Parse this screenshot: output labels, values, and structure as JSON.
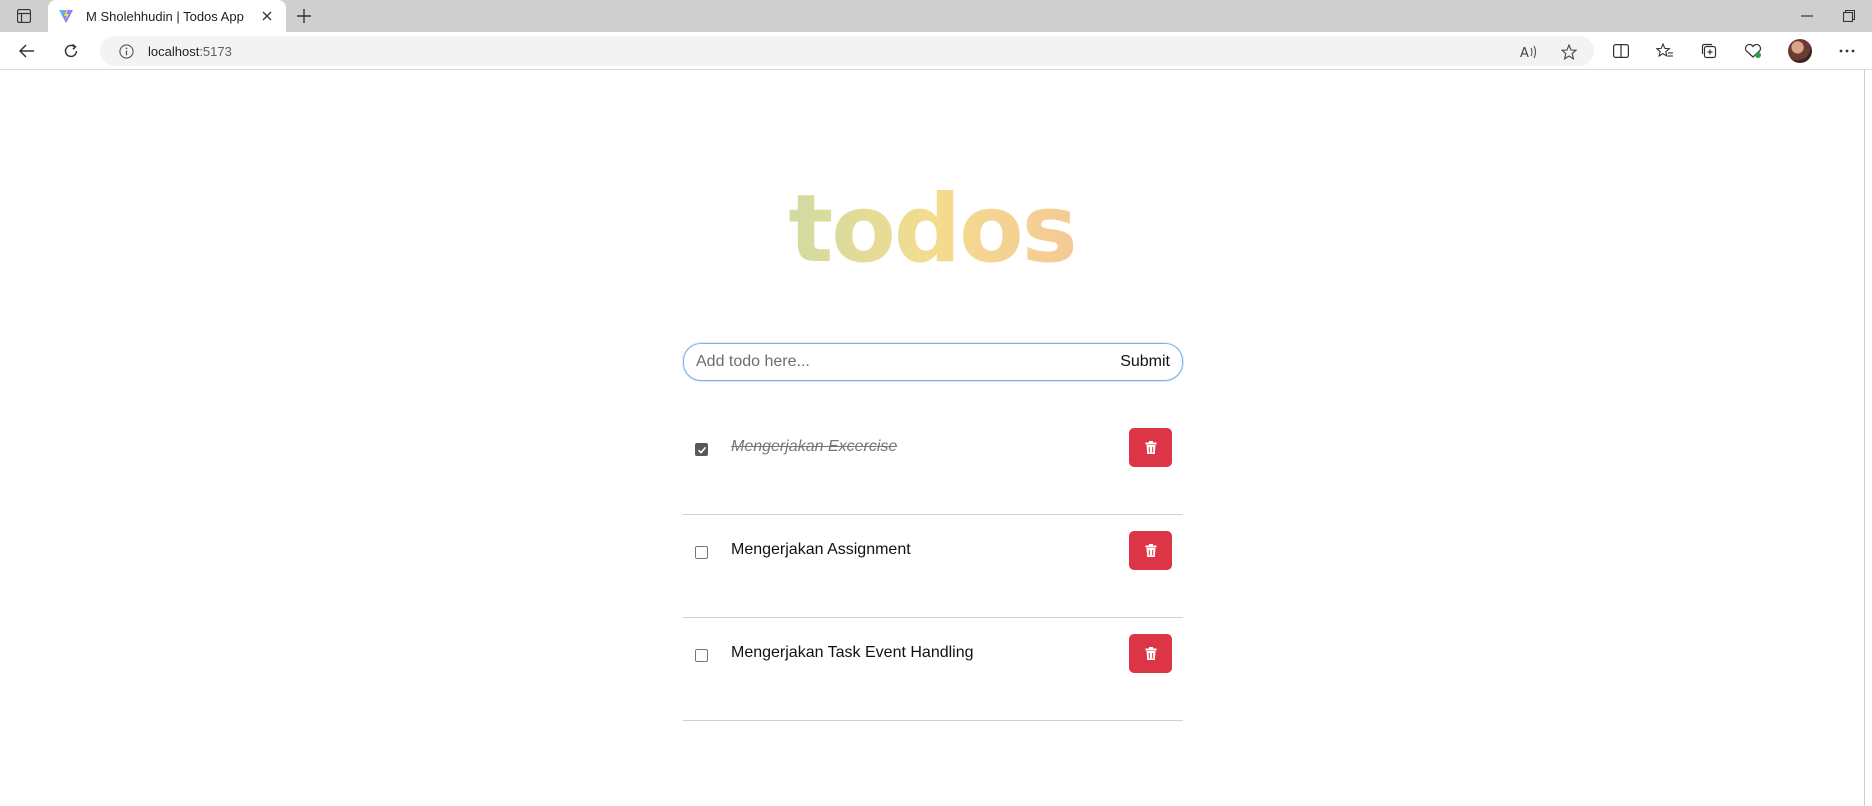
{
  "browser": {
    "tab_title": "M Sholehhudin | Todos App",
    "url_host": "localhost",
    "url_port": ":5173"
  },
  "app": {
    "title": "todos",
    "input_placeholder": "Add todo here...",
    "input_value": "",
    "submit_label": "Submit",
    "title_gradient": [
      "#22c3e6",
      "#7fd8cf",
      "#f4dc8e",
      "#f2a8a4",
      "#e25fd1"
    ],
    "delete_color": "#dc3545"
  },
  "todos": [
    {
      "text": "Mengerjakan Excercise",
      "completed": true
    },
    {
      "text": "Mengerjakan Assignment",
      "completed": false
    },
    {
      "text": "Mengerjakan Task Event Handling",
      "completed": false
    }
  ]
}
